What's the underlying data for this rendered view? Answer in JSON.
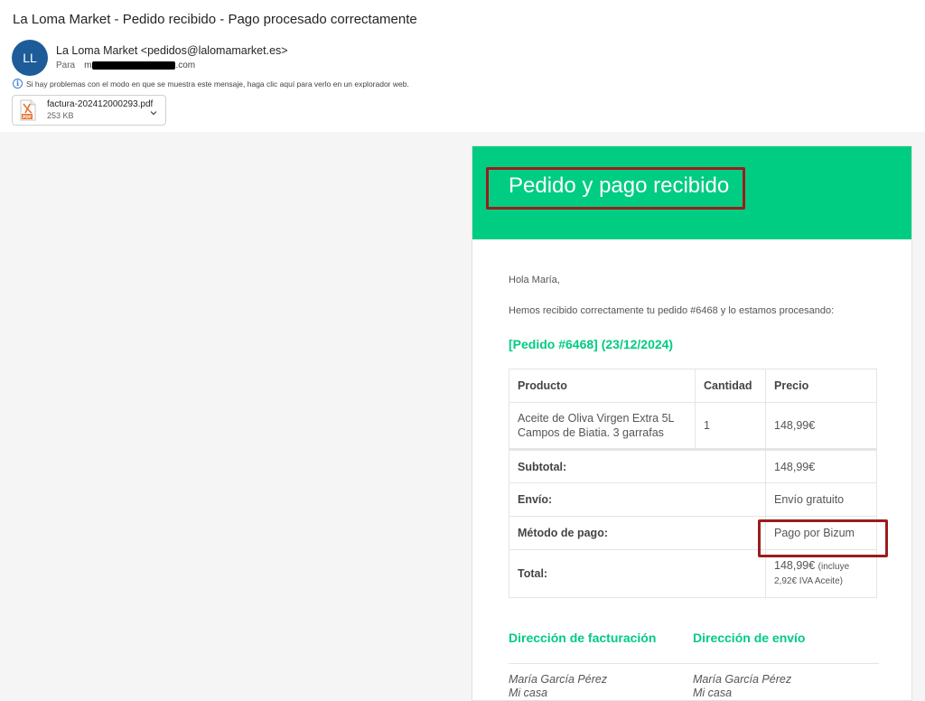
{
  "email": {
    "subject": "La Loma Market - Pedido recibido - Pago procesado correctamente",
    "avatar_initials": "LL",
    "sender": "La Loma Market <pedidos@lalomamarket.es>",
    "to_label": "Para",
    "to_prefix": "m",
    "to_domain": ".com",
    "info_text": "Si hay problemas con el modo en que se muestra este mensaje, haga clic aquí para verlo en un explorador web.",
    "attachment": {
      "name": "factura-202412000293.pdf",
      "size": "253 KB",
      "icon": "pdf-file-icon"
    }
  },
  "message": {
    "banner_title": "Pedido y pago recibido",
    "greeting": "Hola María,",
    "intro": "Hemos recibido correctamente tu pedido #6468 y lo estamos procesando:",
    "order_heading": "[Pedido #6468] (23/12/2024)",
    "table": {
      "headers": [
        "Producto",
        "Cantidad",
        "Precio"
      ],
      "product_line1": "Aceite de Oliva Virgen Extra 5L",
      "product_line2": "Campos de Biatia. 3 garrafas",
      "quantity": "1",
      "price": "148,99€",
      "subtotal_label": "Subtotal:",
      "subtotal_value": "148,99€",
      "shipping_label": "Envío:",
      "shipping_value": "Envío gratuito",
      "payment_label": "Método de pago:",
      "payment_value": "Pago por Bizum",
      "total_label": "Total:",
      "total_value": "148,99€",
      "total_note1": "(incluye",
      "total_note2": "2,92€ IVA Aceite)"
    },
    "billing_heading": "Dirección de facturación",
    "shipping_heading": "Dirección de envío",
    "billing_name": "María García Pérez",
    "billing_line": "Mi casa",
    "shipping_name": "María García Pérez",
    "shipping_line": "Mi casa"
  },
  "colors": {
    "brand_green": "#00cc82",
    "avatar_blue": "#1d5c98",
    "highlight_red": "#9b1c1c"
  }
}
